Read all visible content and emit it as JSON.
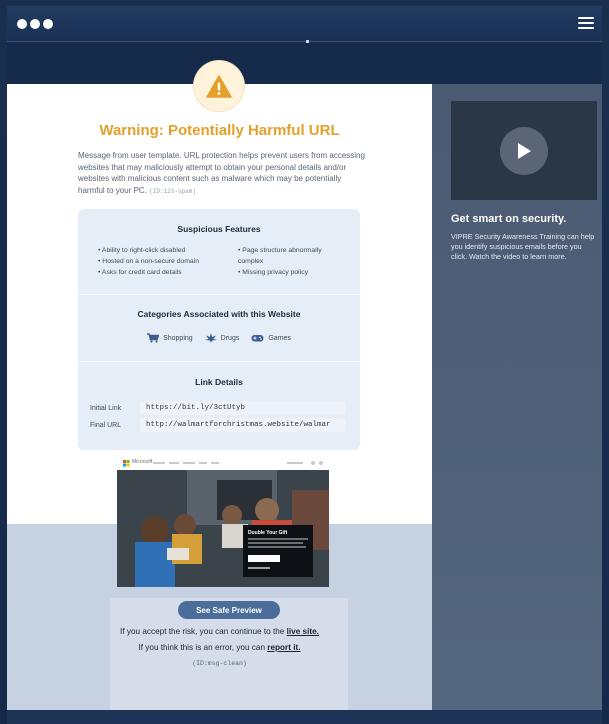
{
  "header": {
    "window_controls_icon": "three-dots",
    "menu_icon": "hamburger"
  },
  "warning": {
    "icon": "warning-triangle",
    "title": "Warning: Potentially Harmful URL",
    "message": "Message from user template. URL protection helps prevent users from accessing websites that may maliciously attempt to obtain your personal details and/or websites with malicious content such as malware which may be potentially harmful to your PC.",
    "message_id": "(ID:123-spam)"
  },
  "suspicious": {
    "title": "Suspicious Features",
    "left": [
      "Ability to right-click disabled",
      "Hosted on a non-secure domain",
      "Asks for credit card details"
    ],
    "right": [
      "Page structure abnormally complex",
      "Missing privacy policy"
    ]
  },
  "categories": {
    "title": "Categories Associated with this Website",
    "items": [
      {
        "label": "Shopping",
        "icon": "cart-icon"
      },
      {
        "label": "Drugs",
        "icon": "leaf-icon"
      },
      {
        "label": "Games",
        "icon": "gamepad-icon"
      }
    ]
  },
  "links": {
    "title": "Link Details",
    "initial_label": "Initial Link",
    "initial_value": "https://bit.ly/3ctUtyb",
    "final_label": "Final URL",
    "final_value": "http://walmartforchristmas.website/walmar"
  },
  "preview": {
    "brand": "Microsoft",
    "overlay_title": "Double Your Gift",
    "button": "See Safe Preview"
  },
  "risk": {
    "line1_prefix": "If you accept the risk, you can continue to the ",
    "line1_link": "live site.",
    "line2_prefix": "If you think this is an error, you can ",
    "line2_link": "report it.",
    "id": "(ID:msg-clean)"
  },
  "sidebar": {
    "title": "Get smart on security.",
    "text": "VIPRE Security Awareness Training can help you identify suspicious emails before you click. Watch the video to learn more."
  },
  "colors": {
    "accent": "#e3a02a",
    "button": "#4a6d9a",
    "sidebar": "#4f5f78"
  }
}
